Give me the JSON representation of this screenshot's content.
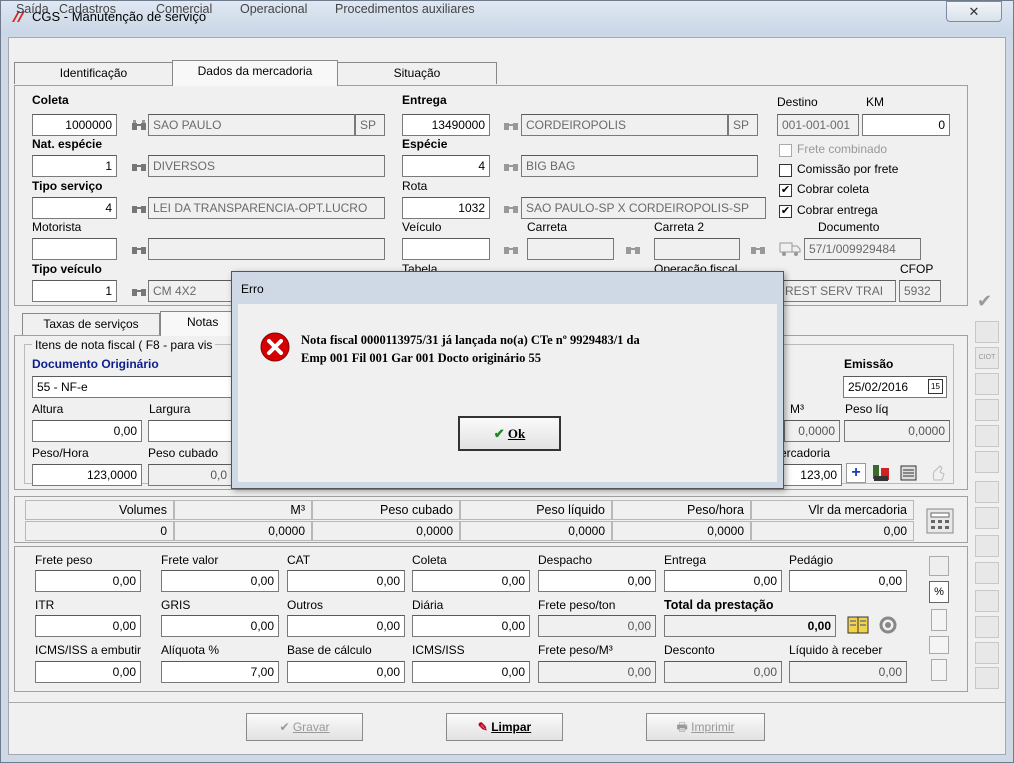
{
  "window": {
    "title": "CGS - Manutenção de serviço",
    "close_glyph": "✕"
  },
  "menu": [
    "Saída",
    "Cadastros",
    "Comercial",
    "Operacional",
    "Procedimentos auxiliares"
  ],
  "tabs": [
    "Identificação",
    "Dados da mercadoria",
    "Situação"
  ],
  "coleta": {
    "label": "Coleta",
    "code": "1000000",
    "city": "SAO PAULO",
    "uf": "SP"
  },
  "entrega": {
    "label": "Entrega",
    "code": "13490000",
    "city": "CORDEIROPOLIS",
    "uf": "SP"
  },
  "destino": {
    "label": "Destino",
    "value": "001-001-001"
  },
  "km": {
    "label": "KM",
    "value": "0"
  },
  "nat_especie": {
    "label": "Nat. espécie",
    "code": "1",
    "desc": "DIVERSOS"
  },
  "especie": {
    "label": "Espécie",
    "code": "4",
    "desc": "BIG BAG"
  },
  "tipo_servico": {
    "label": "Tipo serviço",
    "code": "4",
    "desc": "LEI DA TRANSPARENCIA-OPT.LUCRO"
  },
  "rota": {
    "label": "Rota",
    "code": "1032",
    "desc": "SAO PAULO-SP X CORDEIROPOLIS-SP"
  },
  "motorista": {
    "label": "Motorista",
    "code": "",
    "desc": ""
  },
  "veiculo": {
    "label": "Veículo"
  },
  "carreta": {
    "label": "Carreta"
  },
  "carreta2": {
    "label": "Carreta 2"
  },
  "documento": {
    "label": "Documento",
    "value": "57/1/009929484"
  },
  "tipo_veiculo": {
    "label": "Tipo veículo",
    "code": "1",
    "desc": "CM 4X2"
  },
  "tabela": {
    "label": "Tabela"
  },
  "operacao_fiscal": {
    "label": "Operação fiscal",
    "value": "REST SERV TRAI"
  },
  "cfop": {
    "label": "CFOP",
    "value": "5932"
  },
  "checks": [
    {
      "label": "Frete combinado",
      "checked": false,
      "disabled": true
    },
    {
      "label": "Comissão por frete",
      "checked": false,
      "disabled": false
    },
    {
      "label": "Cobrar coleta",
      "checked": true,
      "disabled": false
    },
    {
      "label": "Cobrar entrega",
      "checked": true,
      "disabled": false
    }
  ],
  "subtabs": [
    "Taxas de serviços",
    "Notas"
  ],
  "itens": {
    "legend": "Itens de nota fiscal ( F8 - para vis",
    "doc_origem_label": "Documento Originário",
    "doc_origem_value": "55 - NF-e",
    "emissao_label": "Emissão",
    "emissao_value": "25/02/2016",
    "altura_label": "Altura",
    "altura_value": "0,00",
    "largura_label": "Largura",
    "m3_label": "M³",
    "m3_value": "0,0000",
    "peso_liq_label": "Peso líq",
    "peso_liq_value": "0,0000",
    "peso_hora_label": "Peso/Hora",
    "peso_hora_value": "123,0000",
    "peso_cubado_label": "Peso cubado",
    "peso_cubado_value": "0,0",
    "vlr_merc_label": "ercadoria",
    "vlr_merc_value": "123,00"
  },
  "totals": {
    "headers": [
      "Volumes",
      "M³",
      "Peso cubado",
      "Peso líquido",
      "Peso/hora",
      "Vlr da mercadoria"
    ],
    "values": [
      "0",
      "0,0000",
      "0,0000",
      "0,0000",
      "0,0000",
      "0,00"
    ]
  },
  "frete": {
    "row1": [
      {
        "label": "Frete peso",
        "value": "0,00"
      },
      {
        "label": "Frete valor",
        "value": "0,00"
      },
      {
        "label": "CAT",
        "value": "0,00"
      },
      {
        "label": "Coleta",
        "value": "0,00"
      },
      {
        "label": "Despacho",
        "value": "0,00"
      },
      {
        "label": "Entrega",
        "value": "0,00"
      },
      {
        "label": "Pedágio",
        "value": "0,00"
      }
    ],
    "row2": [
      {
        "label": "ITR",
        "value": "0,00"
      },
      {
        "label": "GRIS",
        "value": "0,00"
      },
      {
        "label": "Outros",
        "value": "0,00"
      },
      {
        "label": "Diária",
        "value": "0,00"
      },
      {
        "label": "Frete peso/ton",
        "value": "0,00"
      }
    ],
    "total_label": "Total da prestação",
    "total_value": "0,00",
    "row3": [
      {
        "label": "ICMS/ISS a embutir",
        "value": "0,00"
      },
      {
        "label": "Alíquota %",
        "value": "7,00"
      },
      {
        "label": "Base de cálculo",
        "value": "0,00"
      },
      {
        "label": "ICMS/ISS",
        "value": "0,00"
      },
      {
        "label": "Frete peso/M³",
        "value": "0,00"
      },
      {
        "label": "Desconto",
        "value": "0,00"
      },
      {
        "label": "Líquido à receber",
        "value": "0,00"
      }
    ]
  },
  "buttons": {
    "gravar": "Gravar",
    "limpar": "Limpar",
    "imprimir": "Imprimir"
  },
  "dialog": {
    "title": "Erro",
    "message_line1": "Nota fiscal 0000113975/31 já lançada no(a) CTe nº 9929483/1 da",
    "message_line2": "Emp 001 Fil 001 Gar 001 Docto originário 55",
    "ok": "Ok"
  },
  "colors": {
    "dialog_bg": "#cfd9e6",
    "error_red": "#d40000",
    "label_blue": "#0b1e8c"
  }
}
